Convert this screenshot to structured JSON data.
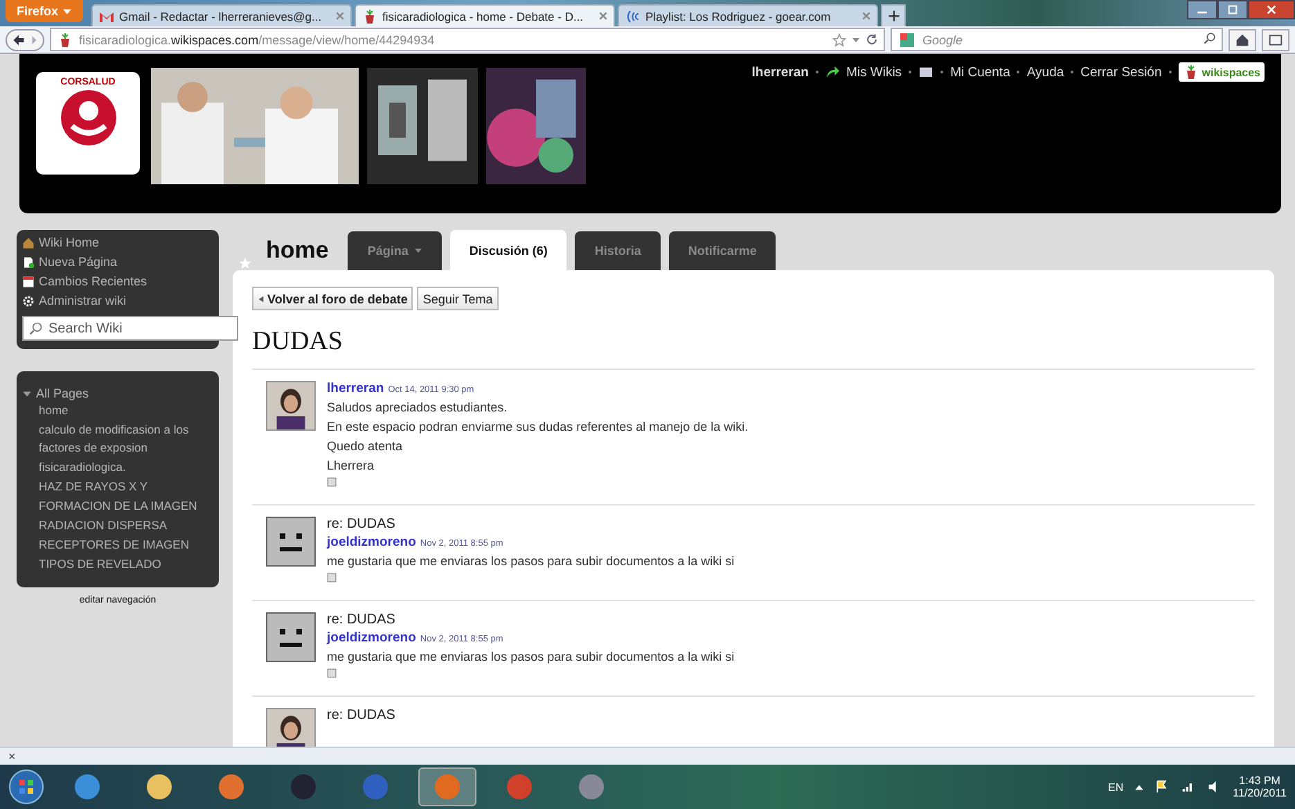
{
  "browser": {
    "menu_button": "Firefox",
    "tabs": [
      {
        "label": "Gmail - Redactar - lherreranieves@g...",
        "selected": false
      },
      {
        "label": "fisicaradiologica - home - Debate - D...",
        "selected": true
      },
      {
        "label": "Playlist: Los Rodriguez - goear.com",
        "selected": false
      }
    ],
    "address": {
      "prefix": "fisicaradiologica.",
      "domain": "wikispaces.com",
      "path": "/message/view/home/44294934"
    },
    "search": {
      "placeholder": "Google"
    }
  },
  "header": {
    "logo_text": "CORSALUD",
    "user": "lherreran",
    "links": [
      "Mis Wikis",
      "Mi Cuenta",
      "Ayuda",
      "Cerrar Sesión"
    ],
    "brand": "wikispaces"
  },
  "sidebar": {
    "nav": [
      "Wiki Home",
      "Nueva Página",
      "Cambios Recientes",
      "Administrar wiki"
    ],
    "search": {
      "placeholder": "Search Wiki"
    },
    "pages": {
      "title": "All Pages",
      "expanded": true,
      "items": [
        "home",
        "calculo de modificasion a los factores de exposion",
        "fisicaradiologica.",
        "HAZ DE RAYOS X Y",
        "FORMACION DE LA IMAGEN",
        "RADIACION DISPERSA",
        "RECEPTORES DE IMAGEN",
        "TIPOS DE REVELADO"
      ]
    },
    "edit_link": "editar navegación"
  },
  "page": {
    "name": "home",
    "tabs": [
      {
        "label": "Página",
        "dropdown": true,
        "selected": false
      },
      {
        "label": "Discusión (6)",
        "dropdown": false,
        "selected": true
      },
      {
        "label": "Historia",
        "dropdown": false,
        "selected": false
      },
      {
        "label": "Notificarme",
        "dropdown": false,
        "selected": false
      }
    ],
    "buttons": [
      {
        "label": "Volver al foro de debate",
        "kind": "back"
      },
      {
        "label": "Seguir Tema",
        "kind": "plain"
      }
    ],
    "heading": "DUDAS",
    "posts": [
      {
        "author": "lherreran",
        "date": "Oct 14, 2011 9:30 pm",
        "lines": [
          "Saludos apreciados estudiantes.",
          "En este espacio podran enviarme sus dudas referentes al manejo de la wiki.",
          "Quedo atenta",
          "Lherrera"
        ]
      },
      {
        "kind": "default",
        "subject": "re: DUDAS",
        "author": "joeldizmoreno",
        "date": "Nov 2, 2011 8:55 pm",
        "lines": [
          "me gustaria que me enviaras los pasos para subir documentos a la wiki si"
        ]
      },
      {
        "kind": "default",
        "subject": "re: DUDAS",
        "author": "joeldizmoreno",
        "date": "Nov 2, 2011 8:55 pm",
        "lines": [
          "me gustaria que me enviaras los pasos para subir documentos a la wiki si"
        ]
      },
      {
        "subject": "re: DUDAS"
      }
    ]
  },
  "addon_bar": {
    "close": "×"
  },
  "taskbar": {
    "language": "EN",
    "time": "1:43 PM",
    "date": "11/20/2011"
  }
}
